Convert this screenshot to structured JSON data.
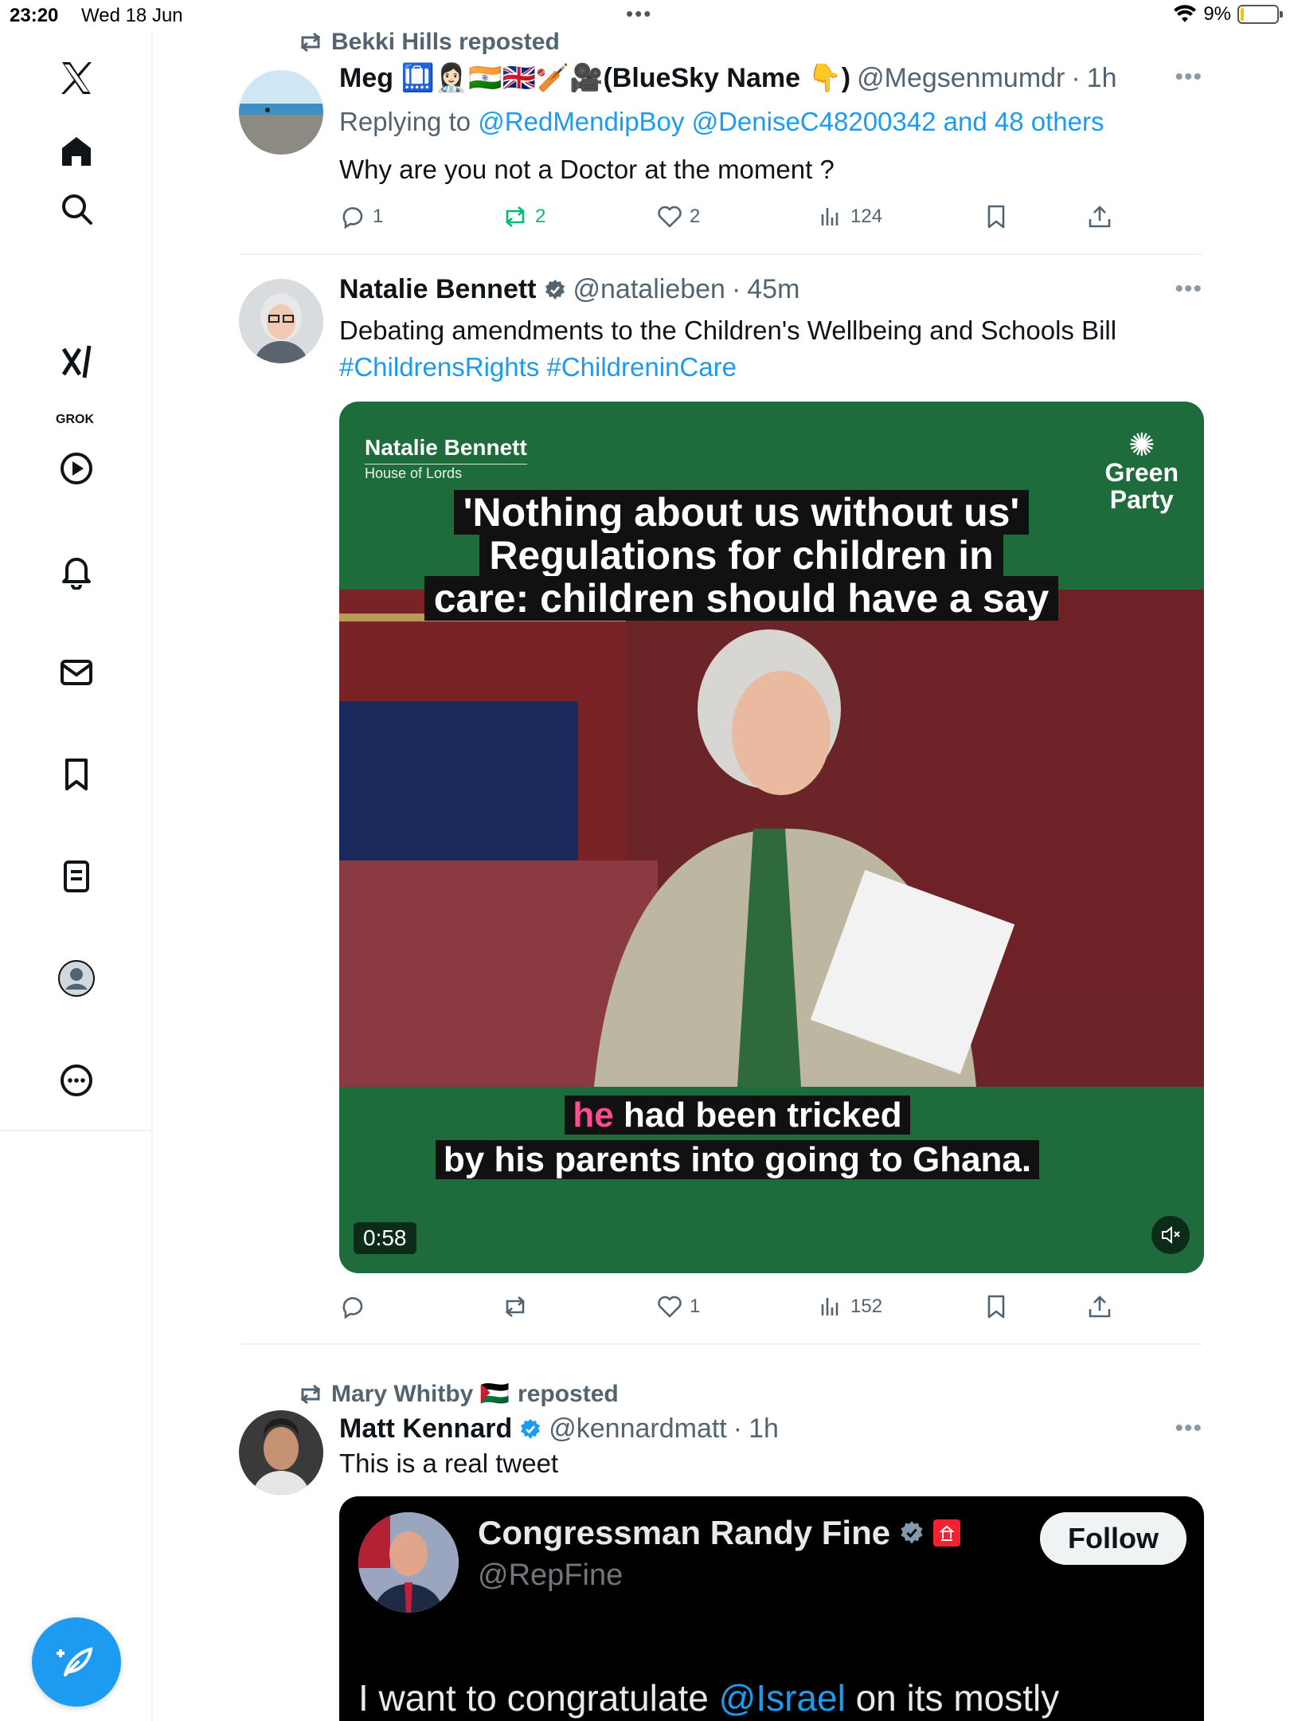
{
  "status_bar": {
    "time": "23:20",
    "date": "Wed 18 Jun",
    "battery": "9%",
    "battery_level": 0.09,
    "center_dots": "•••"
  },
  "sidebar": {
    "grok_label": "GROK",
    "items": [
      "x-logo",
      "home",
      "search",
      "grok",
      "video",
      "notifications",
      "messages",
      "bookmarks",
      "lists",
      "profile",
      "more"
    ]
  },
  "tweets": [
    {
      "repost_by": "Bekki Hills reposted",
      "name": "Meg 🛄👩🏻‍⚕️🇮🇳🇬🇧🏏🎥(BlueSky Name 👇)",
      "handle": "@Megsenmumdr",
      "time": "1h",
      "replying_prefix": "Replying to",
      "replying_to": "@RedMendipBoy @DeniseC48200342 and 48 others",
      "text": "Why are you not a Doctor at the moment ?",
      "stats": {
        "replies": "1",
        "reposts": "2",
        "likes": "2",
        "views": "124"
      }
    },
    {
      "name": "Natalie Bennett",
      "handle": "@natalieben",
      "time": "45m",
      "text": "Debating amendments to the Children's Wellbeing and Schools Bill",
      "hashtags": "#ChildrensRights #ChildreninCare",
      "media": {
        "tag_name": "Natalie Bennett",
        "tag_sub": "House of Lords",
        "logo_line1": "Green",
        "logo_line2": "Party",
        "headline_1": "'Nothing about us without us'",
        "headline_2": "Regulations for children in",
        "headline_3": "care: children should have a say",
        "caption_pink": "he",
        "caption_1": " had been tricked",
        "caption_2": "by his parents into going to Ghana.",
        "duration": "0:58"
      },
      "stats": {
        "replies": "",
        "reposts": "",
        "likes": "1",
        "views": "152"
      }
    },
    {
      "repost_by_name": "Mary Whitby 🇵🇸",
      "repost_suffix": "reposted",
      "name": "Matt Kennard",
      "handle": "@kennardmatt",
      "time": "1h",
      "text": "This is a real tweet",
      "quoted": {
        "name": "Congressman Randy Fine",
        "handle": "@RepFine",
        "follow": "Follow",
        "text_prefix": "I want to congratulate ",
        "text_mention": "@Israel",
        "text_suffix": " on its mostly"
      }
    }
  ],
  "colors": {
    "accent": "#1d9bf0",
    "repost_green": "#00ba7c",
    "green_party": "#1e6b3c"
  }
}
